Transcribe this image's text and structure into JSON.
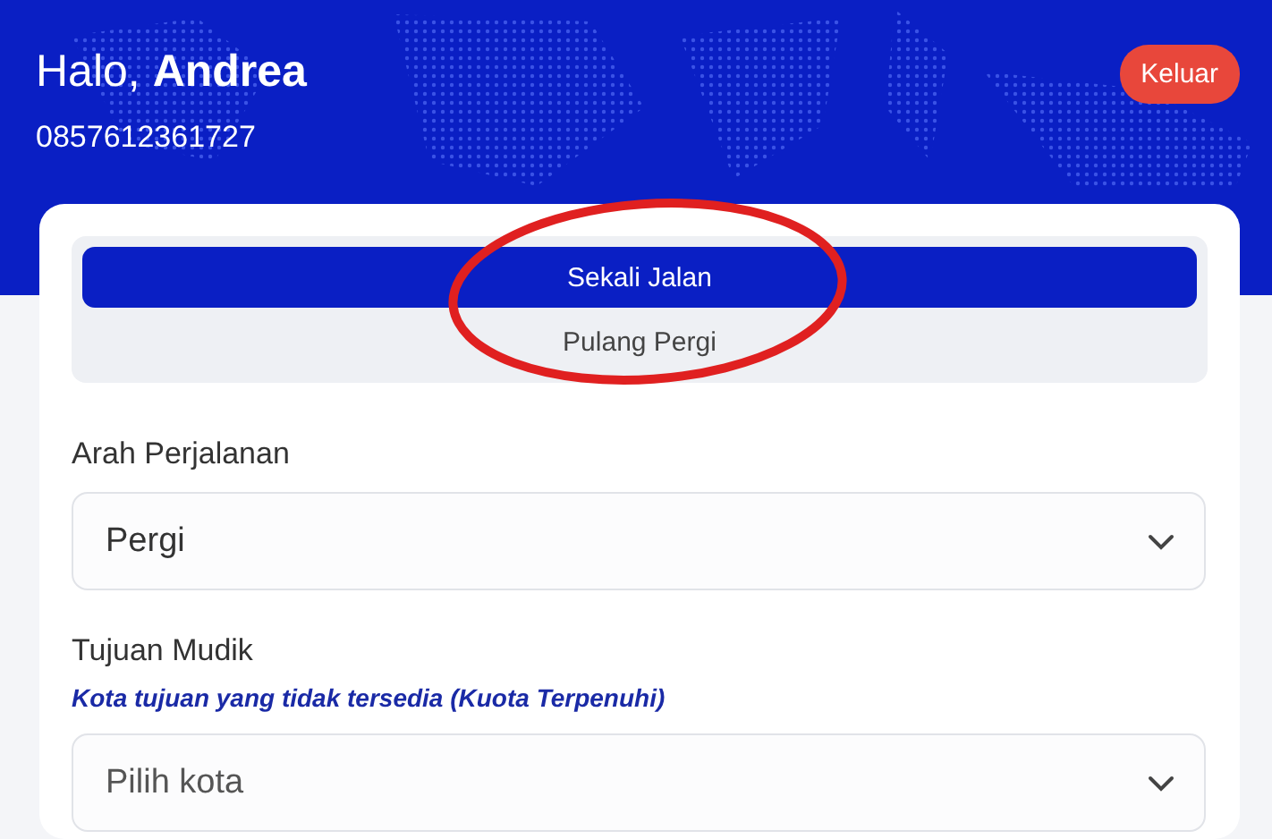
{
  "header": {
    "greeting": "Halo, **Andrea**",
    "phone": "0857612361727",
    "logout_button": "Keluar"
  },
  "trip_type": [
    {
      "label": "Sekali Jalan",
      "selected": true
    },
    {
      "label": "Pulang Pergi",
      "selected": false
    }
  ],
  "fields": [
    {
      "label": "Arah Perjalanan",
      "value": "Pergi"
    },
    {
      "label": "Tujuan Mudik",
      "hint": "Kota tujuan yang tidak tersedia (Kuota Terpenuhi)",
      "placeholder": "Pilih kota"
    }
  ],
  "annotation": {
    "kind": "ellipse"
  }
}
